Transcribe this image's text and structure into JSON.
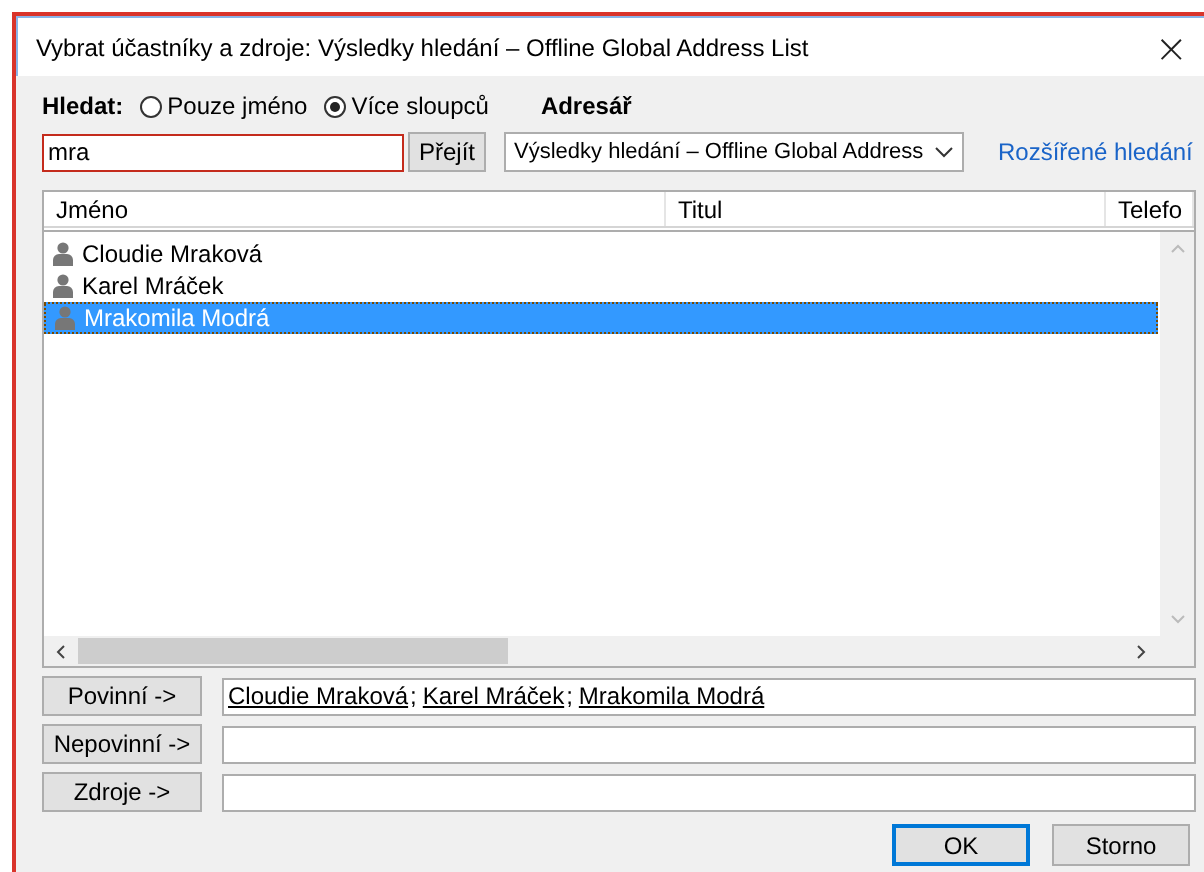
{
  "window": {
    "title": "Vybrat účastníky a zdroje: Výsledky hledání – Offline Global Address List",
    "close": "×"
  },
  "search": {
    "label": "Hledat:",
    "options": [
      {
        "label": "Pouze jméno",
        "selected": false
      },
      {
        "label": "Více sloupců",
        "selected": true
      }
    ],
    "value": "mra",
    "go_button": "Přejít"
  },
  "address_book": {
    "label": "Adresář",
    "value": "Výsledky hledání – Offline Global Address",
    "advanced_link": "Rozšířené hledání"
  },
  "table": {
    "columns": [
      "Jméno",
      "Titul",
      "Telefo"
    ],
    "rows": [
      {
        "name": "Cloudie Mraková",
        "selected": false
      },
      {
        "name": "Karel Mráček",
        "selected": false
      },
      {
        "name": "Mrakomila Modrá",
        "selected": true
      }
    ]
  },
  "recipients": [
    {
      "button": "Povinní ->",
      "entries": [
        "Cloudie Mraková",
        "Karel Mráček",
        "Mrakomila Modrá"
      ],
      "separator": ";"
    },
    {
      "button": "Nepovinní ->"
    },
    {
      "button": "Zdroje ->"
    }
  ],
  "buttons": [
    {
      "label": "OK",
      "default": true
    },
    {
      "label": "Storno",
      "default": false
    }
  ]
}
